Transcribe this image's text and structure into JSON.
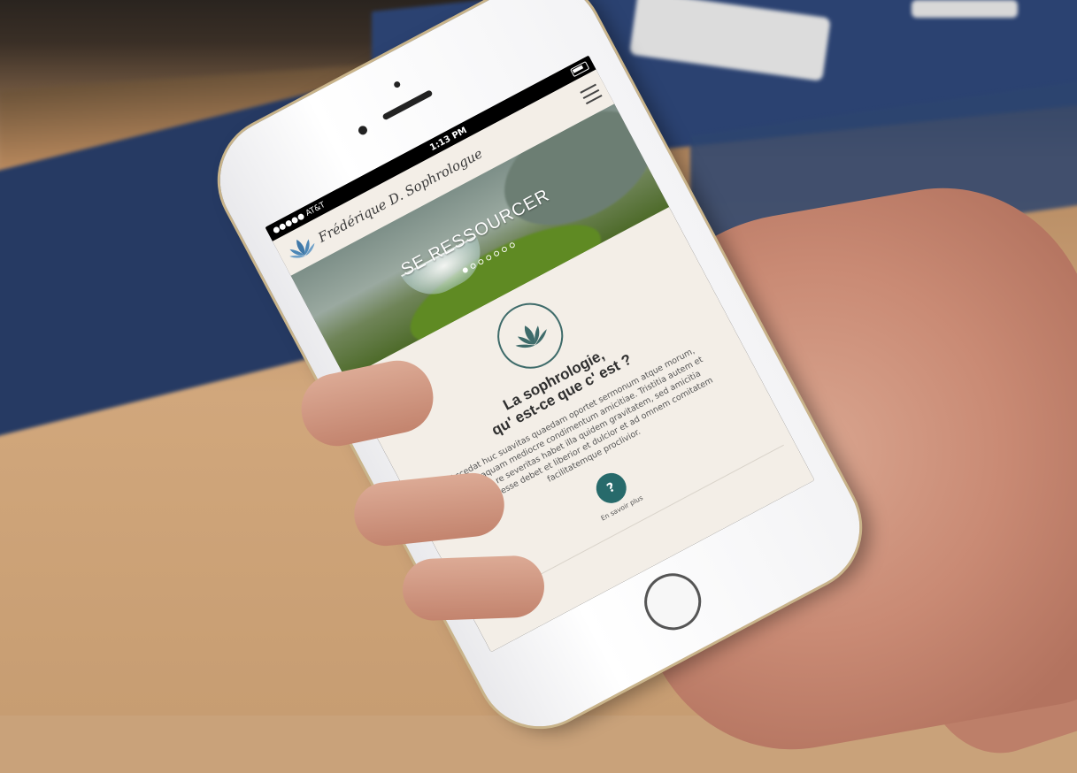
{
  "status_bar": {
    "carrier": "●●●●● AT&T",
    "time": "1:13 PM"
  },
  "site": {
    "brand": "Frédérique D. Sophrologue",
    "hero": {
      "title": "SE RESSOURCER",
      "slides": 7,
      "active_slide": 0
    },
    "section": {
      "heading_line1": "La sophrologie,",
      "heading_line2": "qu' est-ce que c' est ?",
      "paragraph": "Accedat huc suavitas quaedam oportet sermonum atque morum, haudquaquam mediocre condimentum amicitiae. Tristitia autem et in omni re severitas habet illa quidem gravitatem, sed amicitia remissior esse debet et liberior et dulcior et ad omnem comitatem facilitatemque proclivior.",
      "more_button": "?",
      "more_label": "En savoir plus"
    }
  },
  "icons": {
    "menu": "hamburger-icon",
    "lotus": "lotus-icon",
    "wifi": "wifi-icon",
    "battery": "battery-icon"
  },
  "colors": {
    "accent": "#276a6b",
    "page_bg": "#f3eee7"
  }
}
